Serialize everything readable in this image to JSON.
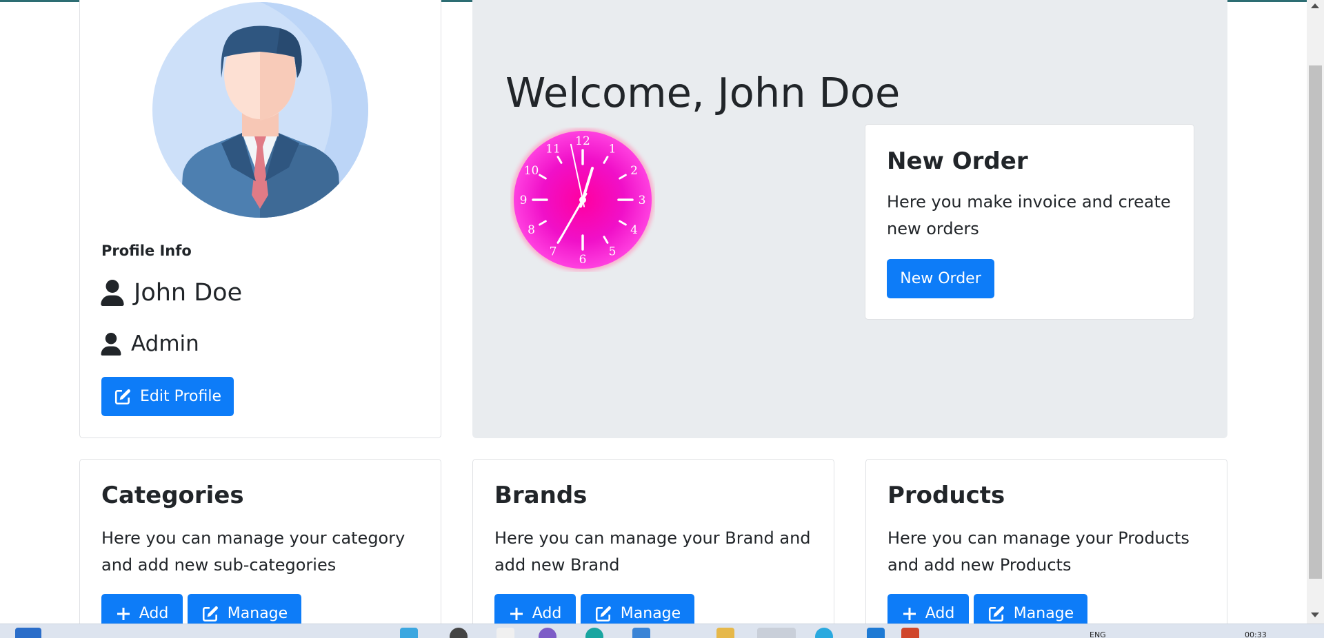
{
  "profile": {
    "heading": "Profile Info",
    "name": "John Doe",
    "role": "Admin",
    "edit_label": "Edit Profile"
  },
  "welcome": {
    "title": "Welcome, John Doe"
  },
  "clock": {
    "numbers": [
      "12",
      "1",
      "2",
      "3",
      "4",
      "5",
      "6",
      "7",
      "8",
      "9",
      "10",
      "11"
    ],
    "hour": 12,
    "minute": 34,
    "second": 58,
    "face_color": "#ff00c8"
  },
  "new_order": {
    "title": "New Order",
    "text": "Here you make invoice and create new orders",
    "button": "New Order"
  },
  "cards": [
    {
      "title": "Categories",
      "text": "Here you can manage your category and add new sub-categories",
      "add": "Add",
      "manage": "Manage"
    },
    {
      "title": "Brands",
      "text": "Here you can manage your Brand and add new Brand",
      "add": "Add",
      "manage": "Manage"
    },
    {
      "title": "Products",
      "text": "Here you can manage your Products and add new Products",
      "add": "Add",
      "manage": "Manage"
    }
  ],
  "taskbar": {
    "lang": "ENG",
    "time": "00:33"
  },
  "colors": {
    "primary": "#0d7cf8",
    "jumbotron": "#e9ecef",
    "clock": "#ff00c8"
  },
  "icons": {
    "user": "user-icon",
    "edit": "edit-icon",
    "plus": "plus-icon"
  }
}
